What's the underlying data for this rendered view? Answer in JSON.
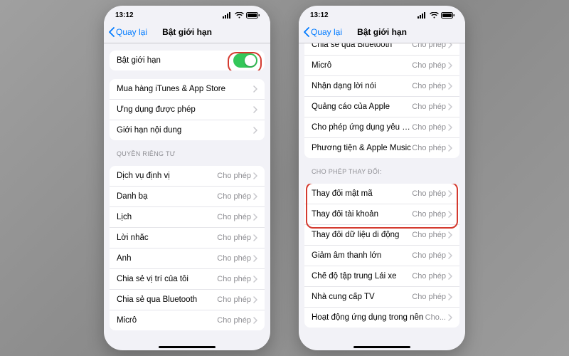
{
  "status": {
    "time": "13:12"
  },
  "nav": {
    "back": "Quay lại",
    "title": "Bật giới hạn"
  },
  "value_allow": "Cho phép",
  "value_allow_trunc": "Cho...",
  "left": {
    "toggle_label": "Bật giới hạn",
    "g1": [
      "Mua hàng iTunes & App Store",
      "Ứng dụng được phép",
      "Giới hạn nội dung"
    ],
    "privacy_header": "QUYỀN RIÊNG TƯ",
    "privacy": [
      "Dịch vụ định vị",
      "Danh bạ",
      "Lịch",
      "Lời nhắc",
      "Ảnh",
      "Chia sẻ vị trí của tôi",
      "Chia sẻ qua Bluetooth",
      "Micrô"
    ]
  },
  "right": {
    "top_partial": "Chia sẻ qua Bluetooth",
    "cont": [
      "Micrô",
      "Nhận dạng lời nói",
      "Quảng cáo của Apple",
      "Cho phép ứng dụng yêu cầu theo dõi",
      "Phương tiện & Apple Music"
    ],
    "changes_header": "CHO PHÉP THAY ĐỔI:",
    "changes": [
      "Thay đổi mật mã",
      "Thay đổi tài khoản",
      "Thay đổi dữ liệu di động",
      "Giảm âm thanh lớn",
      "Chế độ tập trung Lái xe",
      "Nhà cung cấp TV",
      "Hoạt động ứng dụng trong nền"
    ]
  }
}
